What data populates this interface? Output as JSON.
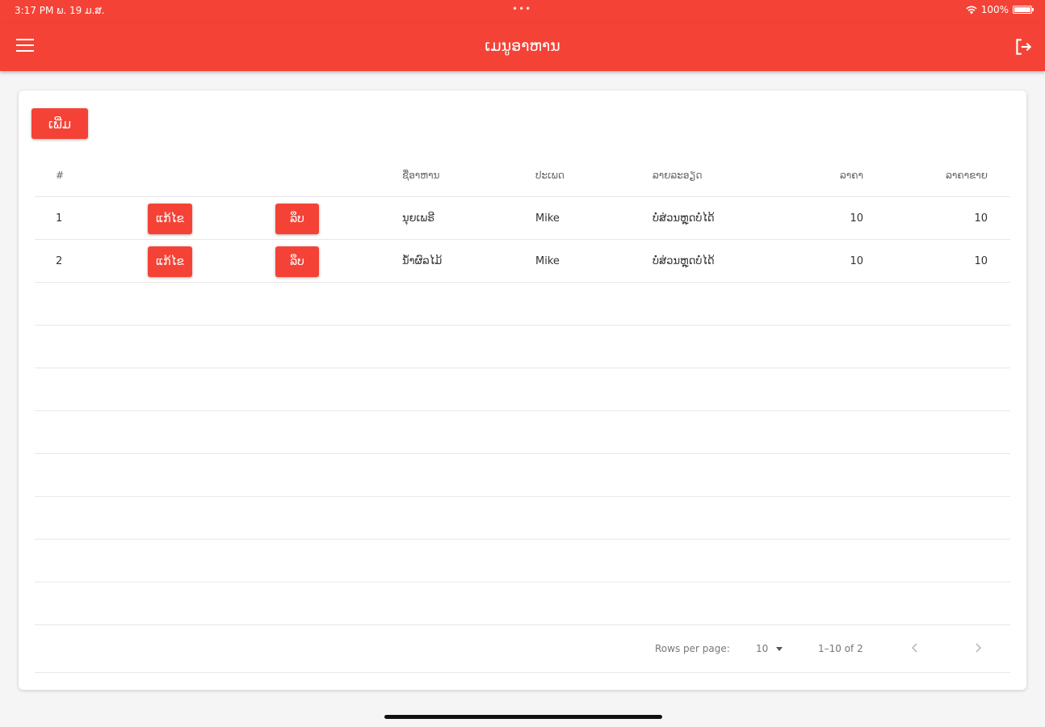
{
  "status_bar": {
    "time": "3:17 PM   ພ. 19 ມ.ສ.",
    "dots": "•••",
    "battery": "100%",
    "battery_level": 1.0
  },
  "app_bar": {
    "title": "ເມນູອາຫານ",
    "menu_icon": "hamburger-menu-icon",
    "logout_icon": "logout-icon"
  },
  "actions": {
    "add_label": "ເພີ່ມ"
  },
  "table": {
    "headers": {
      "num": "#",
      "name": "ຊື່ອາຫານ",
      "category": "ປະເພດ",
      "description": "ລາຍລະອຽດ",
      "price": "ລາຄາ",
      "total": "ລາຄາຂາຍ"
    },
    "rows": [
      {
        "num": "1",
        "edit": "ແກ້ໄຂ",
        "delete": "ລຶບ",
        "name": "ນຸຍເພຣີ",
        "category": "Mike",
        "description": "ບໍ່ສ່ວນຫຼຸດບໍ່ໄດ້",
        "price": "10",
        "total": "10"
      },
      {
        "num": "2",
        "edit": "ແກ້ໄຂ",
        "delete": "ລຶບ",
        "name": "ນ້ຳຜົລໄມ້",
        "category": "Mike",
        "description": "ບໍ່ສ່ວນຫຼຸດບໍ່ໄດ້",
        "price": "10",
        "total": "10"
      }
    ]
  },
  "pagination": {
    "rows_per_page_label": "Rows per page:",
    "rows_per_page_value": "10",
    "range": "1–10 of 2"
  },
  "colors": {
    "primary": "#f44336",
    "background": "#f5f5f5"
  }
}
